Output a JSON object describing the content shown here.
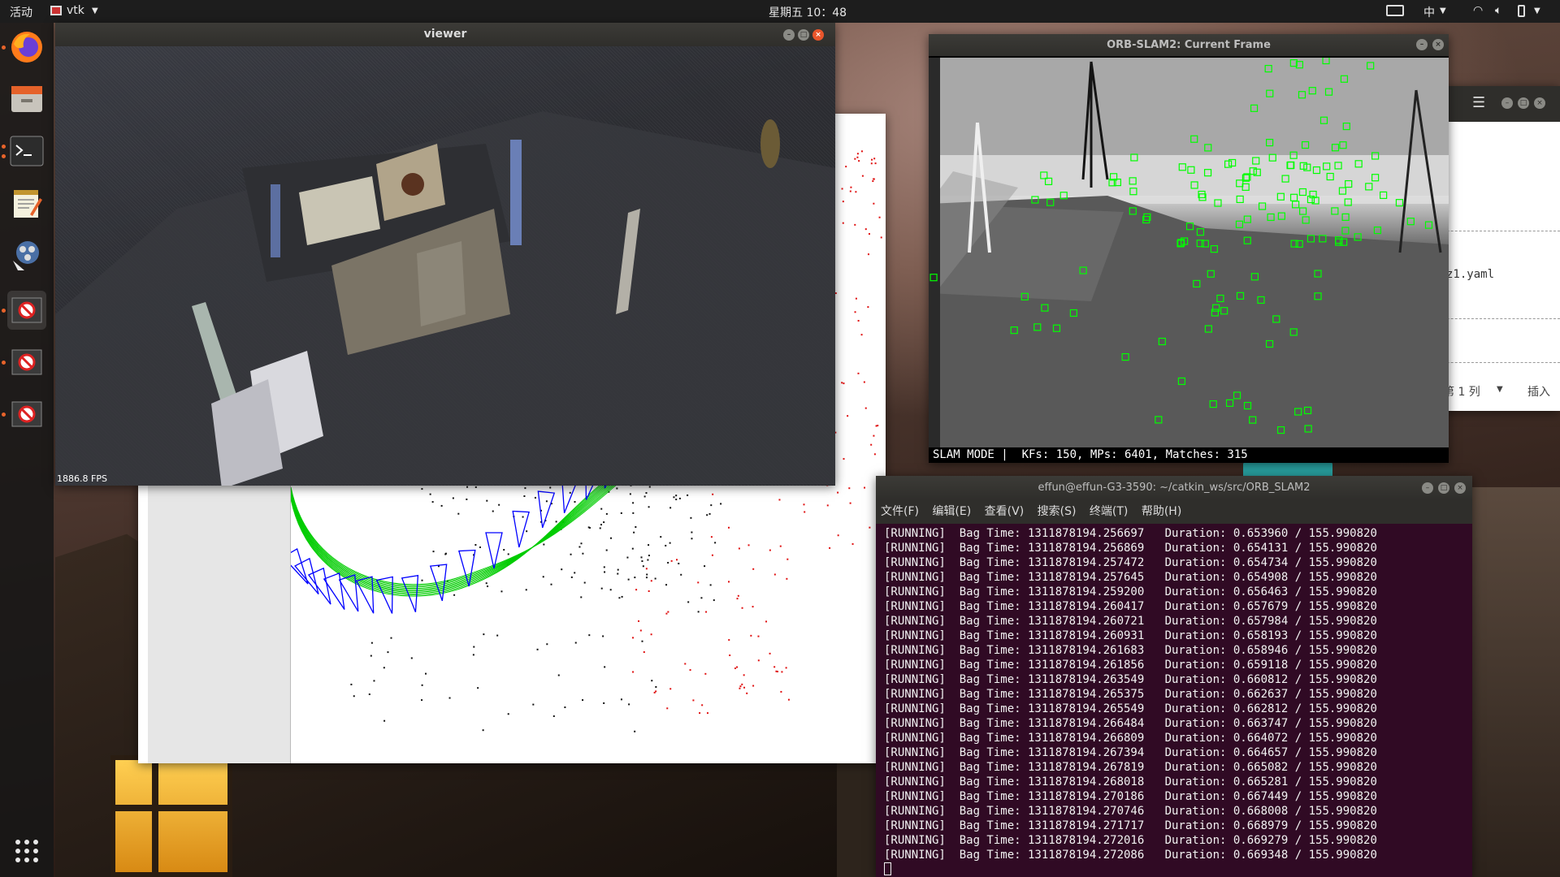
{
  "topbar": {
    "activities": "活动",
    "app_name": "vtk",
    "clock": "星期五 10：48",
    "input_method": "中"
  },
  "viewer": {
    "title": "viewer",
    "fps": "1886.8 FPS"
  },
  "orb_frame": {
    "title": "ORB-SLAM2: Current Frame",
    "status": "SLAM MODE |  KFs: 150, MPs: 6401, Matches: 315"
  },
  "editor": {
    "filename_fragment": "z1.yaml",
    "cursor_pos": "第 1 列",
    "insert_mode": "插入"
  },
  "terminal": {
    "title": "effun@effun-G3-3590: ~/catkin_ws/src/ORB_SLAM2",
    "menu": [
      "文件(F)",
      "编辑(E)",
      "查看(V)",
      "搜索(S)",
      "终端(T)",
      "帮助(H)"
    ],
    "lines": [
      "[RUNNING]  Bag Time: 1311878194.256697   Duration: 0.653960 / 155.990820",
      "[RUNNING]  Bag Time: 1311878194.256869   Duration: 0.654131 / 155.990820",
      "[RUNNING]  Bag Time: 1311878194.257472   Duration: 0.654734 / 155.990820",
      "[RUNNING]  Bag Time: 1311878194.257645   Duration: 0.654908 / 155.990820",
      "[RUNNING]  Bag Time: 1311878194.259200   Duration: 0.656463 / 155.990820",
      "[RUNNING]  Bag Time: 1311878194.260417   Duration: 0.657679 / 155.990820",
      "[RUNNING]  Bag Time: 1311878194.260721   Duration: 0.657984 / 155.990820",
      "[RUNNING]  Bag Time: 1311878194.260931   Duration: 0.658193 / 155.990820",
      "[RUNNING]  Bag Time: 1311878194.261683   Duration: 0.658946 / 155.990820",
      "[RUNNING]  Bag Time: 1311878194.261856   Duration: 0.659118 / 155.990820",
      "[RUNNING]  Bag Time: 1311878194.263549   Duration: 0.660812 / 155.990820",
      "[RUNNING]  Bag Time: 1311878194.265375   Duration: 0.662637 / 155.990820",
      "[RUNNING]  Bag Time: 1311878194.265549   Duration: 0.662812 / 155.990820",
      "[RUNNING]  Bag Time: 1311878194.266484   Duration: 0.663747 / 155.990820",
      "[RUNNING]  Bag Time: 1311878194.266809   Duration: 0.664072 / 155.990820",
      "[RUNNING]  Bag Time: 1311878194.267394   Duration: 0.664657 / 155.990820",
      "[RUNNING]  Bag Time: 1311878194.267819   Duration: 0.665082 / 155.990820",
      "[RUNNING]  Bag Time: 1311878194.268018   Duration: 0.665281 / 155.990820",
      "[RUNNING]  Bag Time: 1311878194.270186   Duration: 0.667449 / 155.990820",
      "[RUNNING]  Bag Time: 1311878194.270746   Duration: 0.668008 / 155.990820",
      "[RUNNING]  Bag Time: 1311878194.271717   Duration: 0.668979 / 155.990820",
      "[RUNNING]  Bag Time: 1311878194.272016   Duration: 0.669279 / 155.990820",
      "[RUNNING]  Bag Time: 1311878194.272086   Duration: 0.669348 / 155.990820"
    ]
  },
  "colors": {
    "topbar": "#1d1d1d",
    "dock": "#161616",
    "terminal_bg": "#300a24",
    "feature": "#00ff00",
    "keyframe": "#0000ff",
    "trajectory": "#00cc00",
    "accent_close": "#e9552b"
  }
}
